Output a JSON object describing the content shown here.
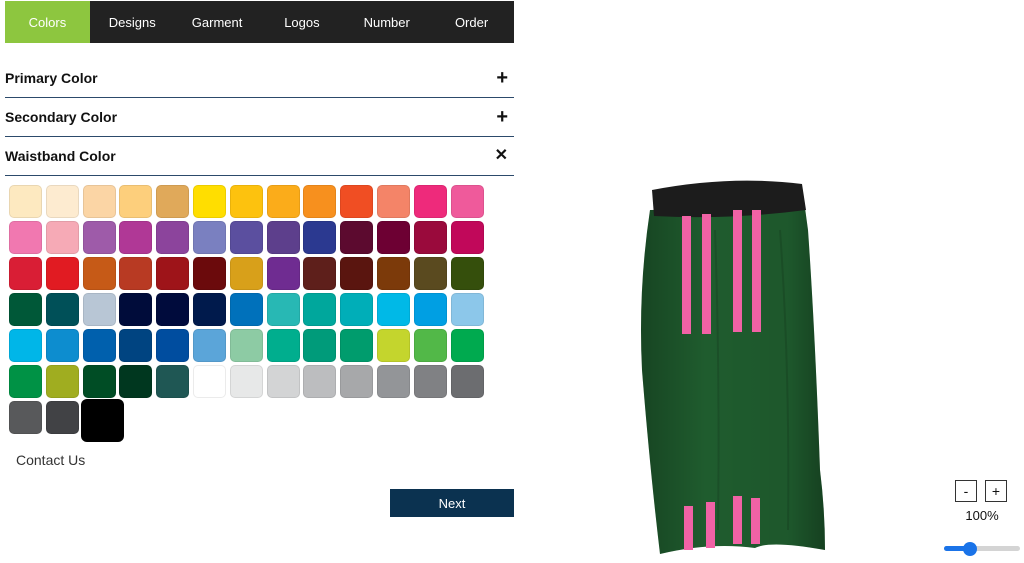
{
  "tabs": [
    {
      "label": "Colors",
      "active": true
    },
    {
      "label": "Designs",
      "active": false
    },
    {
      "label": "Garment",
      "active": false
    },
    {
      "label": "Logos",
      "active": false
    },
    {
      "label": "Number",
      "active": false
    },
    {
      "label": "Order",
      "active": false
    }
  ],
  "accordion": {
    "primary": {
      "label": "Primary Color",
      "icon": "plus-icon",
      "glyph": "+"
    },
    "secondary": {
      "label": "Secondary Color",
      "icon": "plus-icon",
      "glyph": "+"
    },
    "waistband": {
      "label": "Waistband Color",
      "icon": "close-icon",
      "glyph": "✕"
    }
  },
  "swatches": [
    [
      "#fde9c0",
      "#fdebd0",
      "#fbd5a5",
      "#fdcf7c",
      "#e0a95a",
      "#ffde00",
      "#fdc20e",
      "#fbac1a",
      "#f7901e",
      "#f04e23",
      "#f48468",
      "#ee2a7b",
      "#ef5a9b"
    ],
    [
      "#f178b0",
      "#f6aab6",
      "#9e5ba9",
      "#b03896",
      "#8c449c",
      "#7a80c0",
      "#5b4f9f",
      "#5d3f8c",
      "#2b3990",
      "#5c0a2f",
      "#6d0033",
      "#9a0a3c",
      "#c1085a"
    ],
    [
      "#d91e35",
      "#e11b22",
      "#c65a17",
      "#b83a23",
      "#9e1419",
      "#6b0a0c",
      "#d8a01a",
      "#6f2c91",
      "#5e1f1b",
      "#5a150f",
      "#7c3a0a",
      "#5a4a1f",
      "#354f0c"
    ],
    [
      "#005838",
      "#005058",
      "#b8c6d5",
      "#000c3a",
      "#000b3c",
      "#001a4c",
      "#0071bb",
      "#28b8b4",
      "#00a79c",
      "#00aeb8",
      "#00b9e7",
      "#009fe3",
      "#8cc7ea"
    ],
    [
      "#00b6e8",
      "#0d8dcf",
      "#0060ad",
      "#004481",
      "#004d9f",
      "#5ba5d9",
      "#8dcba4",
      "#00ae8e",
      "#009b7a",
      "#009c6d",
      "#c4d52d",
      "#52b848",
      "#00aa4f"
    ],
    [
      "#009245",
      "#a0ad20",
      "#004d25",
      "#00371f",
      "#1f5754",
      "#ffffff",
      "#e7e8e8",
      "#d3d4d5",
      "#bcbdbf",
      "#a7a8aa",
      "#939598",
      "#808184",
      "#6c6d70"
    ],
    [
      "#58595b",
      "#414245",
      "#000000"
    ]
  ],
  "selected_swatch": "#000000",
  "contact_label": "Contact Us",
  "next_label": "Next",
  "garment": {
    "base": "#1f5c2e",
    "stripe": "#f062a5",
    "waistband": "#1c1c1c"
  },
  "zoom": {
    "minus_label": "-",
    "plus_label": "+",
    "percent_label": "100%",
    "level": 0.3
  },
  "colors": {
    "active_tab": "#8dc63f",
    "tab_bar": "#222222",
    "button": "#0b3250",
    "slider": "#1a73e8"
  }
}
